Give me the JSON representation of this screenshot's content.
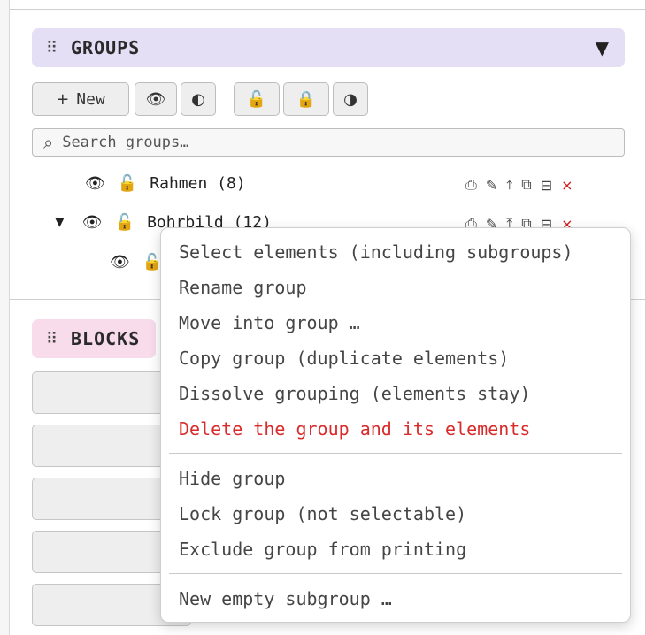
{
  "groups_panel": {
    "title": "GROUPS",
    "grip_icon": "drag-grip-icon",
    "collapse_icon": "triangle-down-icon",
    "toolbar": {
      "new_label": "New",
      "plus": "+",
      "show_all": "👁",
      "toggle_visibility": "◐",
      "unlock_all": "🔓",
      "lock_all": "🔒",
      "toggle_lock": "◑"
    },
    "search": {
      "placeholder": "Search groups…",
      "icon": "🔍"
    },
    "rows": [
      {
        "name": "Rahmen (8)",
        "eye": "👁",
        "lock": "🔓"
      },
      {
        "name": "Bohrbild (12)",
        "eye": "👁",
        "lock": "🔓",
        "expander": "▼"
      },
      {
        "eye": "👁",
        "lock": "🔓"
      }
    ],
    "row_actions": {
      "print": "⎙",
      "edit": "✎",
      "top": "⤒",
      "copy": "⧉",
      "dissolve": "⊟",
      "delete": "×"
    }
  },
  "blocks_panel": {
    "title": "BLOCKS"
  },
  "context_menu": {
    "items": [
      "Select elements (including subgroups)",
      "Rename group",
      "Move into group …",
      "Copy group (duplicate elements)",
      "Dissolve grouping (elements stay)",
      "Delete the group and its elements",
      "Hide group",
      "Lock group (not selectable)",
      "Exclude group from printing",
      "New empty subgroup …"
    ],
    "danger_color": "#d92b2b"
  }
}
